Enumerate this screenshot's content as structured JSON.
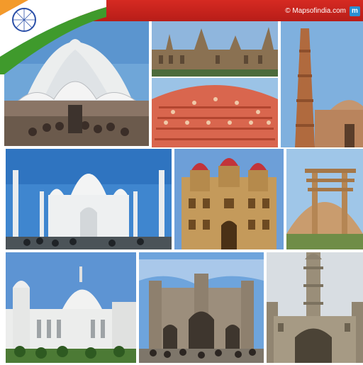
{
  "watermark": {
    "text": "© Mapsofindia.com",
    "badge_letter": "m"
  },
  "flag_colors": {
    "saffron": "#f39a2b",
    "white": "#ffffff",
    "green": "#3f9a2c",
    "chakra": "#2a4fa8"
  },
  "tiles": [
    {
      "subject": "lotus-temple"
    },
    {
      "subject": "cst-terminus"
    },
    {
      "subject": "qutub-minar"
    },
    {
      "subject": "hawa-mahal"
    },
    {
      "subject": "taj-mahal"
    },
    {
      "subject": "mysore-palace"
    },
    {
      "subject": "sanchi-stupa"
    },
    {
      "subject": "victoria-memorial"
    },
    {
      "subject": "gateway-of-india"
    },
    {
      "subject": "charminar"
    }
  ]
}
